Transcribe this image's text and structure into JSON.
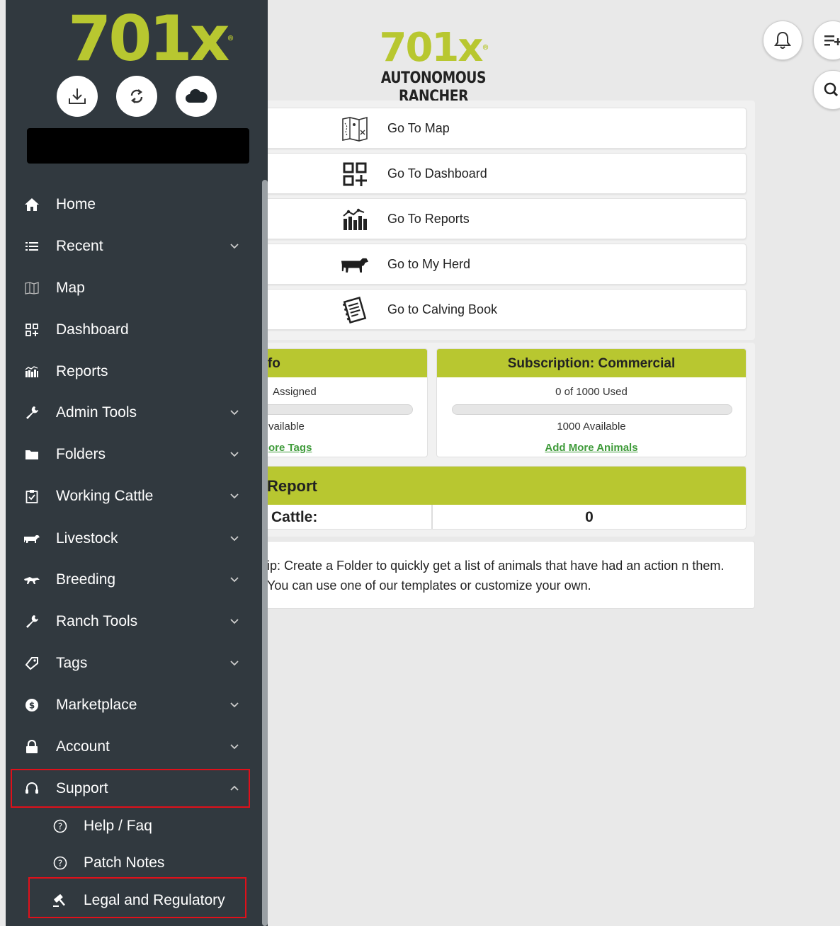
{
  "brand": {
    "logo": "701x",
    "mark": "®",
    "tagline": "AUTONOMOUS RANCHER"
  },
  "header_icons": [
    "bell-icon",
    "list-add-icon",
    "search-icon"
  ],
  "sidebar": {
    "logo": "701x",
    "mark": "®",
    "quick_icons": [
      "download-icon",
      "sync-icon",
      "cloud-icon"
    ],
    "items": [
      {
        "label": "Home",
        "icon": "home-icon",
        "chevron": false
      },
      {
        "label": "Recent",
        "icon": "list-icon",
        "chevron": true
      },
      {
        "label": "Map",
        "icon": "map-icon",
        "chevron": false
      },
      {
        "label": "Dashboard",
        "icon": "dashboard-icon",
        "chevron": false
      },
      {
        "label": "Reports",
        "icon": "reports-icon",
        "chevron": false
      },
      {
        "label": "Admin Tools",
        "icon": "wrench-icon",
        "chevron": true
      },
      {
        "label": "Folders",
        "icon": "folder-icon",
        "chevron": true
      },
      {
        "label": "Working Cattle",
        "icon": "clipboard-check-icon",
        "chevron": true
      },
      {
        "label": "Livestock",
        "icon": "cow-icon",
        "chevron": true
      },
      {
        "label": "Breeding",
        "icon": "bull-icon",
        "chevron": true
      },
      {
        "label": "Ranch Tools",
        "icon": "wrench-icon",
        "chevron": true
      },
      {
        "label": "Tags",
        "icon": "tag-icon",
        "chevron": true
      },
      {
        "label": "Marketplace",
        "icon": "dollar-icon",
        "chevron": true
      },
      {
        "label": "Account",
        "icon": "lock-icon",
        "chevron": true
      },
      {
        "label": "Support",
        "icon": "headset-icon",
        "chevron": true,
        "expanded": true
      }
    ],
    "support_children": [
      {
        "label": "Help / Faq",
        "icon": "question-circle-icon"
      },
      {
        "label": "Patch Notes",
        "icon": "question-circle-icon"
      },
      {
        "label": "Legal and Regulatory",
        "icon": "gavel-icon"
      }
    ]
  },
  "nav_buttons": [
    {
      "label": "Go To Map",
      "icon": "map-icon"
    },
    {
      "label": "Go To Dashboard",
      "icon": "dashboard-icon"
    },
    {
      "label": "Go To Reports",
      "icon": "reports-icon"
    },
    {
      "label": "Go to My Herd",
      "icon": "cow-icon"
    },
    {
      "label": "Go to Calving Book",
      "icon": "notebook-icon"
    }
  ],
  "tag_card": {
    "title": "Info",
    "assigned": "Assigned",
    "available": "vailable",
    "link": "ore Tags"
  },
  "subscription_card": {
    "title": "Subscription: Commercial",
    "used": "0 of 1000 Used",
    "used_fraction": 0,
    "available": "1000 Available",
    "link": "Add More Animals"
  },
  "report": {
    "title": "Report",
    "row_label": "Cattle:",
    "row_value": "0"
  },
  "tip": {
    "text": "ip: Create a Folder to quickly get a list of animals that have had an action n them. You can use one of our templates or customize your own."
  },
  "colors": {
    "accent": "#b8c730",
    "sidebar_bg": "#31393f",
    "highlight": "#e0101a",
    "link": "#3f9b3a"
  }
}
